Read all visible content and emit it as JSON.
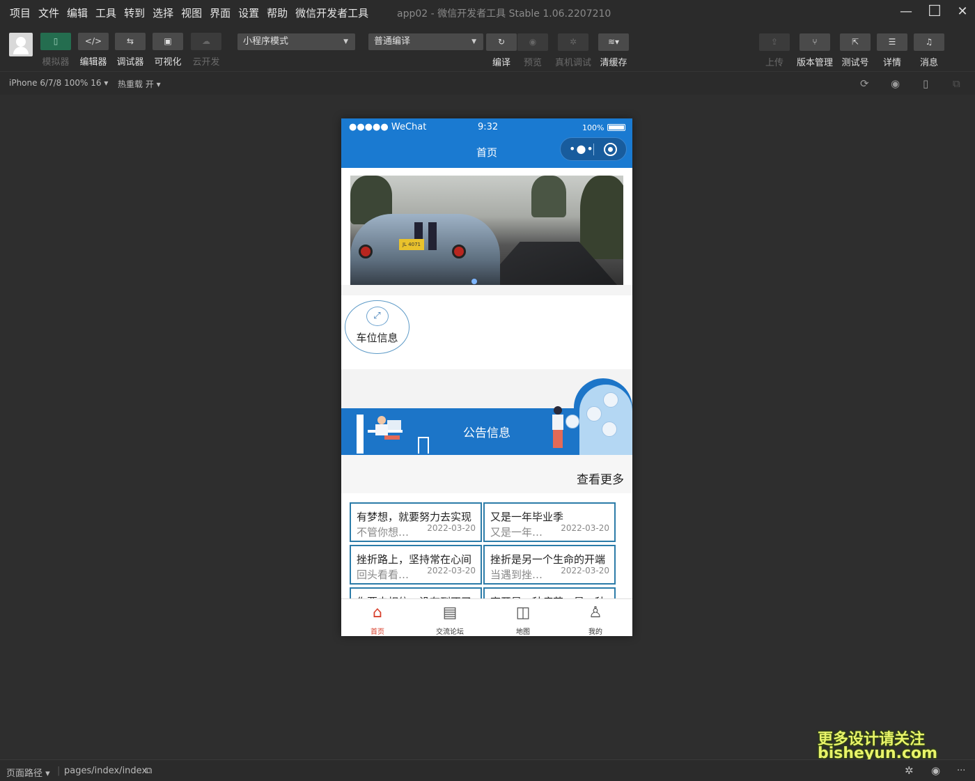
{
  "menubar": {
    "items": [
      "项目",
      "文件",
      "编辑",
      "工具",
      "转到",
      "选择",
      "视图",
      "界面",
      "设置",
      "帮助",
      "微信开发者工具"
    ],
    "title": "app02 - 微信开发者工具 Stable 1.06.2207210"
  },
  "toolbar": {
    "left_buttons": [
      {
        "label": "模拟器",
        "icon": "phone-icon"
      },
      {
        "label": "编辑器",
        "icon": "code-icon"
      },
      {
        "label": "调试器",
        "icon": "debugger-icon"
      },
      {
        "label": "可视化",
        "icon": "layout-icon"
      },
      {
        "label": "云开发",
        "icon": "cloud-icon"
      }
    ],
    "mode_select": "小程序模式",
    "compile_select": "普通编译",
    "mid_buttons": [
      {
        "label": "编译",
        "icon": "refresh-icon"
      },
      {
        "label": "预览",
        "icon": "eye-icon"
      },
      {
        "label": "真机调试",
        "icon": "bug-icon"
      },
      {
        "label": "清缓存",
        "icon": "layers-icon"
      }
    ],
    "right_buttons": [
      {
        "label": "上传",
        "icon": "upload-icon"
      },
      {
        "label": "版本管理",
        "icon": "branch-icon"
      },
      {
        "label": "测试号",
        "icon": "external-link-icon"
      },
      {
        "label": "详情",
        "icon": "menu-icon"
      },
      {
        "label": "消息",
        "icon": "bell-icon"
      }
    ]
  },
  "subbar": {
    "device": "iPhone 6/7/8 100% 16 ▾",
    "hotreload": "热重载 开 ▾"
  },
  "phone": {
    "status_left": "●●●●● WeChat",
    "status_time": "9:32",
    "status_battery": "100%",
    "nav_title": "首页",
    "category_label": "车位信息",
    "notice_title": "公告信息",
    "more_label": "查看更多",
    "plate": "JL 4071",
    "cards": [
      {
        "title": "有梦想，就要努力去实现",
        "summary": "不管你想…",
        "date": "2022-03-20"
      },
      {
        "title": "又是一年毕业季",
        "summary": "又是一年…",
        "date": "2022-03-20"
      },
      {
        "title": "挫折路上，坚持常在心间",
        "summary": "回头看看…",
        "date": "2022-03-20"
      },
      {
        "title": "挫折是另一个生命的开端",
        "summary": "当遇到挫…",
        "date": "2022-03-20"
      },
      {
        "title": "你要去相信，没有到不了",
        "summary": "",
        "date": ""
      },
      {
        "title": "离开是一种痛苦，是一种",
        "summary": "",
        "date": ""
      }
    ],
    "tabs": [
      {
        "label": "首页",
        "icon": "home-icon",
        "active": true
      },
      {
        "label": "交流论坛",
        "icon": "chat-icon",
        "active": false
      },
      {
        "label": "地图",
        "icon": "map-icon",
        "active": false
      },
      {
        "label": "我的",
        "icon": "user-icon",
        "active": false
      }
    ]
  },
  "footer": {
    "path_label": "页面路径 ▾",
    "path": "pages/index/index"
  },
  "watermark": {
    "line1": "更多设计请关注",
    "line2": "bisheyun.com"
  },
  "colors": {
    "accent": "#1a7ad1",
    "tab_active": "#d8402c",
    "card_border": "#2b7ba8"
  }
}
